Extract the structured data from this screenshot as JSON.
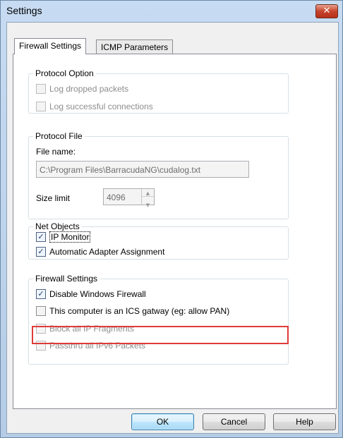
{
  "window": {
    "title": "Settings",
    "close_glyph": "✕"
  },
  "tabs": [
    {
      "label": "Firewall Settings",
      "active": true
    },
    {
      "label": "ICMP Parameters",
      "active": false
    }
  ],
  "protocol_option": {
    "legend": "Protocol Option",
    "items": [
      {
        "label": "Log dropped packets",
        "checked": false,
        "enabled": false
      },
      {
        "label": "Log successful connections",
        "checked": false,
        "enabled": false
      }
    ]
  },
  "protocol_file": {
    "legend": "Protocol File",
    "file_name_label": "File name:",
    "file_name_value": "C:\\Program Files\\BarracudaNG\\cudalog.txt",
    "size_limit_label": "Size limit",
    "size_limit_value": "4096",
    "spin_up": "▲",
    "spin_down": "▼"
  },
  "net_objects": {
    "legend": "Net Objects",
    "items": [
      {
        "label": "IP Monitor",
        "checked": true,
        "enabled": true
      },
      {
        "label": "Automatic Adapter Assignment",
        "checked": true,
        "enabled": true
      }
    ]
  },
  "firewall_settings": {
    "legend": "Firewall Settings",
    "items": [
      {
        "label": "Disable Windows Firewall",
        "checked": true,
        "enabled": true
      },
      {
        "label": "This computer is an ICS gatway (eg: allow PAN)",
        "checked": false,
        "enabled": true,
        "highlighted": true
      },
      {
        "label": "Block all IP Fragments",
        "checked": false,
        "enabled": false
      },
      {
        "label": "Passthru all IPv6 Packets",
        "checked": false,
        "enabled": false
      }
    ]
  },
  "buttons": {
    "ok": "OK",
    "cancel": "Cancel",
    "help": "Help"
  },
  "check_glyph": "✓",
  "colors": {
    "highlight": "#e03a3a",
    "close_button": "#c7442c",
    "default_button": "#3c7fb1"
  }
}
